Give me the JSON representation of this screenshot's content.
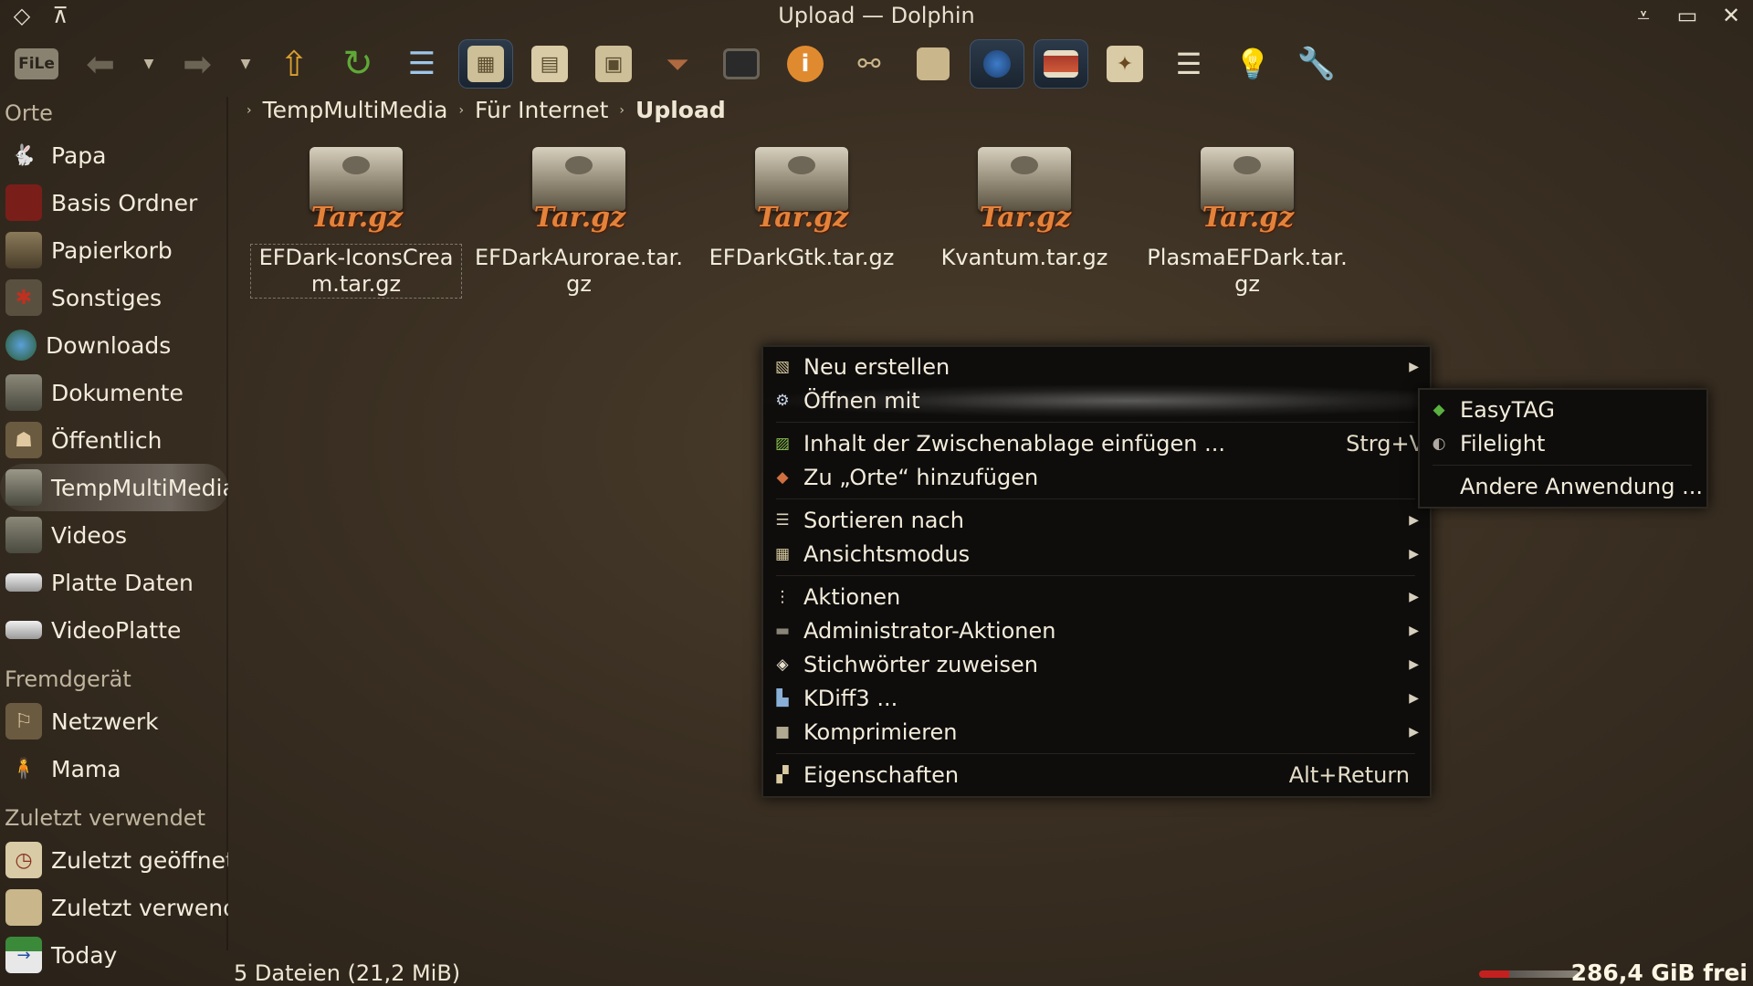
{
  "window": {
    "title": "Upload — Dolphin",
    "buttons": {
      "left": [
        "diamond-icon",
        "keep-above-icon"
      ],
      "right": [
        "minimize-icon",
        "maximize-icon",
        "close-icon"
      ]
    }
  },
  "toolbar": {
    "file_label": "FiLe",
    "items": [
      "file-menu",
      "back",
      "back-dropdown",
      "forward",
      "forward-dropdown",
      "home",
      "reload",
      "details-view",
      "icons-view",
      "compact-view",
      "preview",
      "filter",
      "terminal",
      "info",
      "find",
      "places",
      "globe",
      "split",
      "bookmark",
      "list",
      "tip",
      "settings"
    ]
  },
  "sidebar": {
    "sections": [
      {
        "title": "Orte",
        "items": [
          "Papa",
          "Basis Ordner",
          "Papierkorb",
          "Sonstiges",
          "Downloads",
          "Dokumente",
          "Öffentlich",
          "TempMultiMedia",
          "Videos",
          "Platte Daten",
          "VideoPlatte"
        ]
      },
      {
        "title": "Fremdgerät",
        "items": [
          "Netzwerk",
          "Mama"
        ]
      },
      {
        "title": "Zuletzt verwendet",
        "items": [
          "Zuletzt geöffnet",
          "Zuletzt verwendet",
          "Today"
        ]
      }
    ],
    "selected": "TempMultiMedia"
  },
  "breadcrumb": [
    "TempMultiMedia",
    "Für Internet",
    "Upload"
  ],
  "files": [
    {
      "name": "EFDark-IconsCream.tar.gz",
      "badge": "Tar.gz"
    },
    {
      "name": "EFDarkAurorae.tar.gz",
      "badge": "Tar.gz"
    },
    {
      "name": "EFDarkGtk.tar.gz",
      "badge": "Tar.gz"
    },
    {
      "name": "Kvantum.tar.gz",
      "badge": "Tar.gz"
    },
    {
      "name": "PlasmaEFDark.tar.gz",
      "badge": "Tar.gz"
    }
  ],
  "context_menu": {
    "items": [
      {
        "label": "Neu erstellen",
        "has_submenu": true
      },
      {
        "label": "Öffnen mit",
        "has_submenu": false
      },
      {
        "label": "Inhalt der Zwischenablage einfügen ...",
        "shortcut": "Strg+V"
      },
      {
        "label": "Zu „Orte“ hinzufügen"
      },
      {
        "label": "Sortieren nach",
        "has_submenu": true
      },
      {
        "label": "Ansichtsmodus",
        "has_submenu": true
      },
      {
        "label": "Aktionen",
        "has_submenu": true
      },
      {
        "label": "Administrator-Aktionen",
        "has_submenu": true
      },
      {
        "label": "Stichwörter zuweisen",
        "has_submenu": true
      },
      {
        "label": "KDiff3 ...",
        "has_submenu": true
      },
      {
        "label": "Komprimieren",
        "has_submenu": true
      },
      {
        "label": "Eigenschaften",
        "shortcut": "Alt+Return"
      }
    ]
  },
  "submenu": {
    "items": [
      "EasyTAG",
      "Filelight",
      "Andere Anwendung ..."
    ]
  },
  "status": {
    "summary": "5 Dateien (21,2 MiB)",
    "free": "286,4 GiB frei",
    "used_fraction": 0.3
  }
}
